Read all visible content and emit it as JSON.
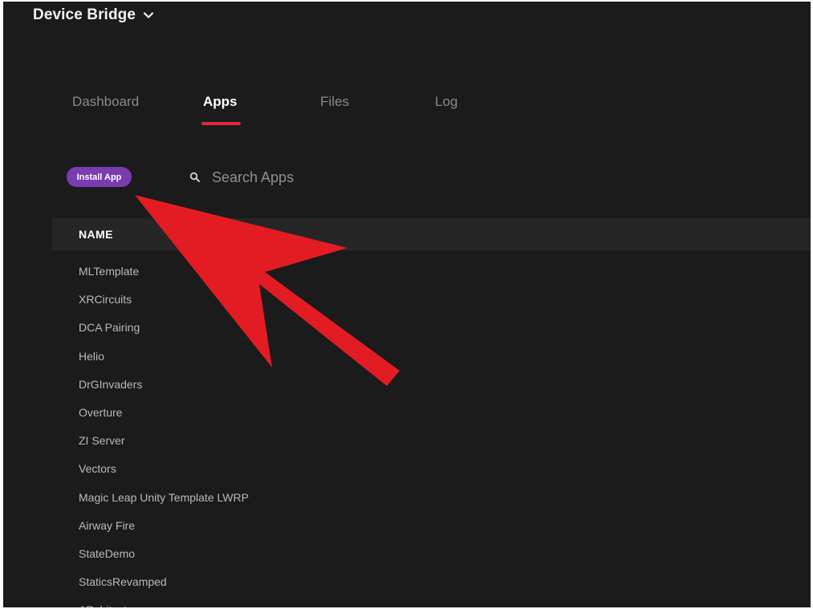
{
  "app": {
    "title": "Device Bridge",
    "title_menu_icon": "chevron-down-icon"
  },
  "tabs": [
    {
      "label": "Dashboard",
      "active": false
    },
    {
      "label": "Apps",
      "active": true
    },
    {
      "label": "Files",
      "active": false
    },
    {
      "label": "Log",
      "active": false
    }
  ],
  "toolbar": {
    "install_label": "Install App",
    "search_placeholder": "Search Apps",
    "search_value": "",
    "search_icon": "search-icon"
  },
  "table": {
    "header": "NAME",
    "rows": [
      "MLTemplate",
      "XRCircuits",
      "DCA Pairing",
      "Helio",
      "DrGInvaders",
      "Overture",
      "ZI Server",
      "Vectors",
      "Magic Leap Unity Template LWRP",
      "Airway Fire",
      "StateDemo",
      "StaticsRevamped",
      "ARchitect"
    ]
  },
  "colors": {
    "background": "#1b1b1c",
    "header_bar": "#262627",
    "accent_underline": "#e0263a",
    "install_button": "#7a3bb0",
    "annotation_arrow": "#e31b23"
  },
  "annotation": {
    "type": "arrow",
    "target": "install-app-button",
    "icon": "annotation-arrow"
  }
}
